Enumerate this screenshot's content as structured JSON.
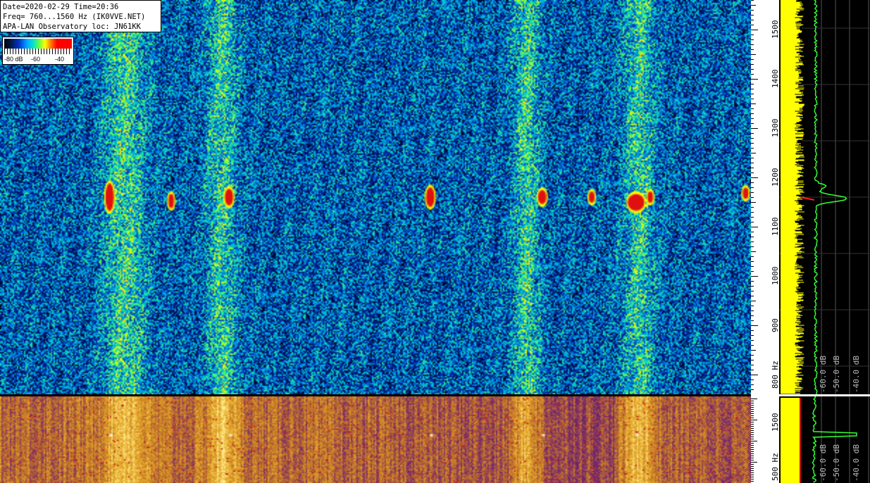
{
  "header": {
    "line1": "Date=2020-02-29 Time=20:36",
    "line2": "Freq= 760...1560 Hz (IK0VVE.NET)",
    "line3": "APA-LAN Observatory loc: JN61KK"
  },
  "color_scale": {
    "labels": [
      "-80 dB",
      "-60",
      "-40"
    ],
    "colors": [
      "#000000",
      "#0033cc",
      "#00aaff",
      "#66ff44",
      "#ffff00",
      "#ff8800",
      "#ff0000"
    ]
  },
  "top_axis": {
    "labels": [
      "1500",
      "1400",
      "1300",
      "1200",
      "1100",
      "1000",
      "900",
      "800 Hz"
    ],
    "values": [
      1500,
      1400,
      1300,
      1200,
      1100,
      1000,
      900,
      800
    ],
    "range": [
      760,
      1560
    ]
  },
  "bottom_axis": {
    "labels": [
      "1500",
      "500 Hz"
    ]
  },
  "top_spectrum": {
    "db_labels": [
      "-60.0 dB",
      "-50.0 dB",
      "-40.0 dB"
    ]
  },
  "bottom_spectrum": {
    "db_labels": [
      "-60.0 dB",
      "-50.0 dB",
      "-40.0 dB"
    ]
  },
  "echoes_hz": [
    1170,
    1160,
    1165,
    1170,
    1165,
    1165,
    1162,
    1160,
    1150,
    1165
  ]
}
